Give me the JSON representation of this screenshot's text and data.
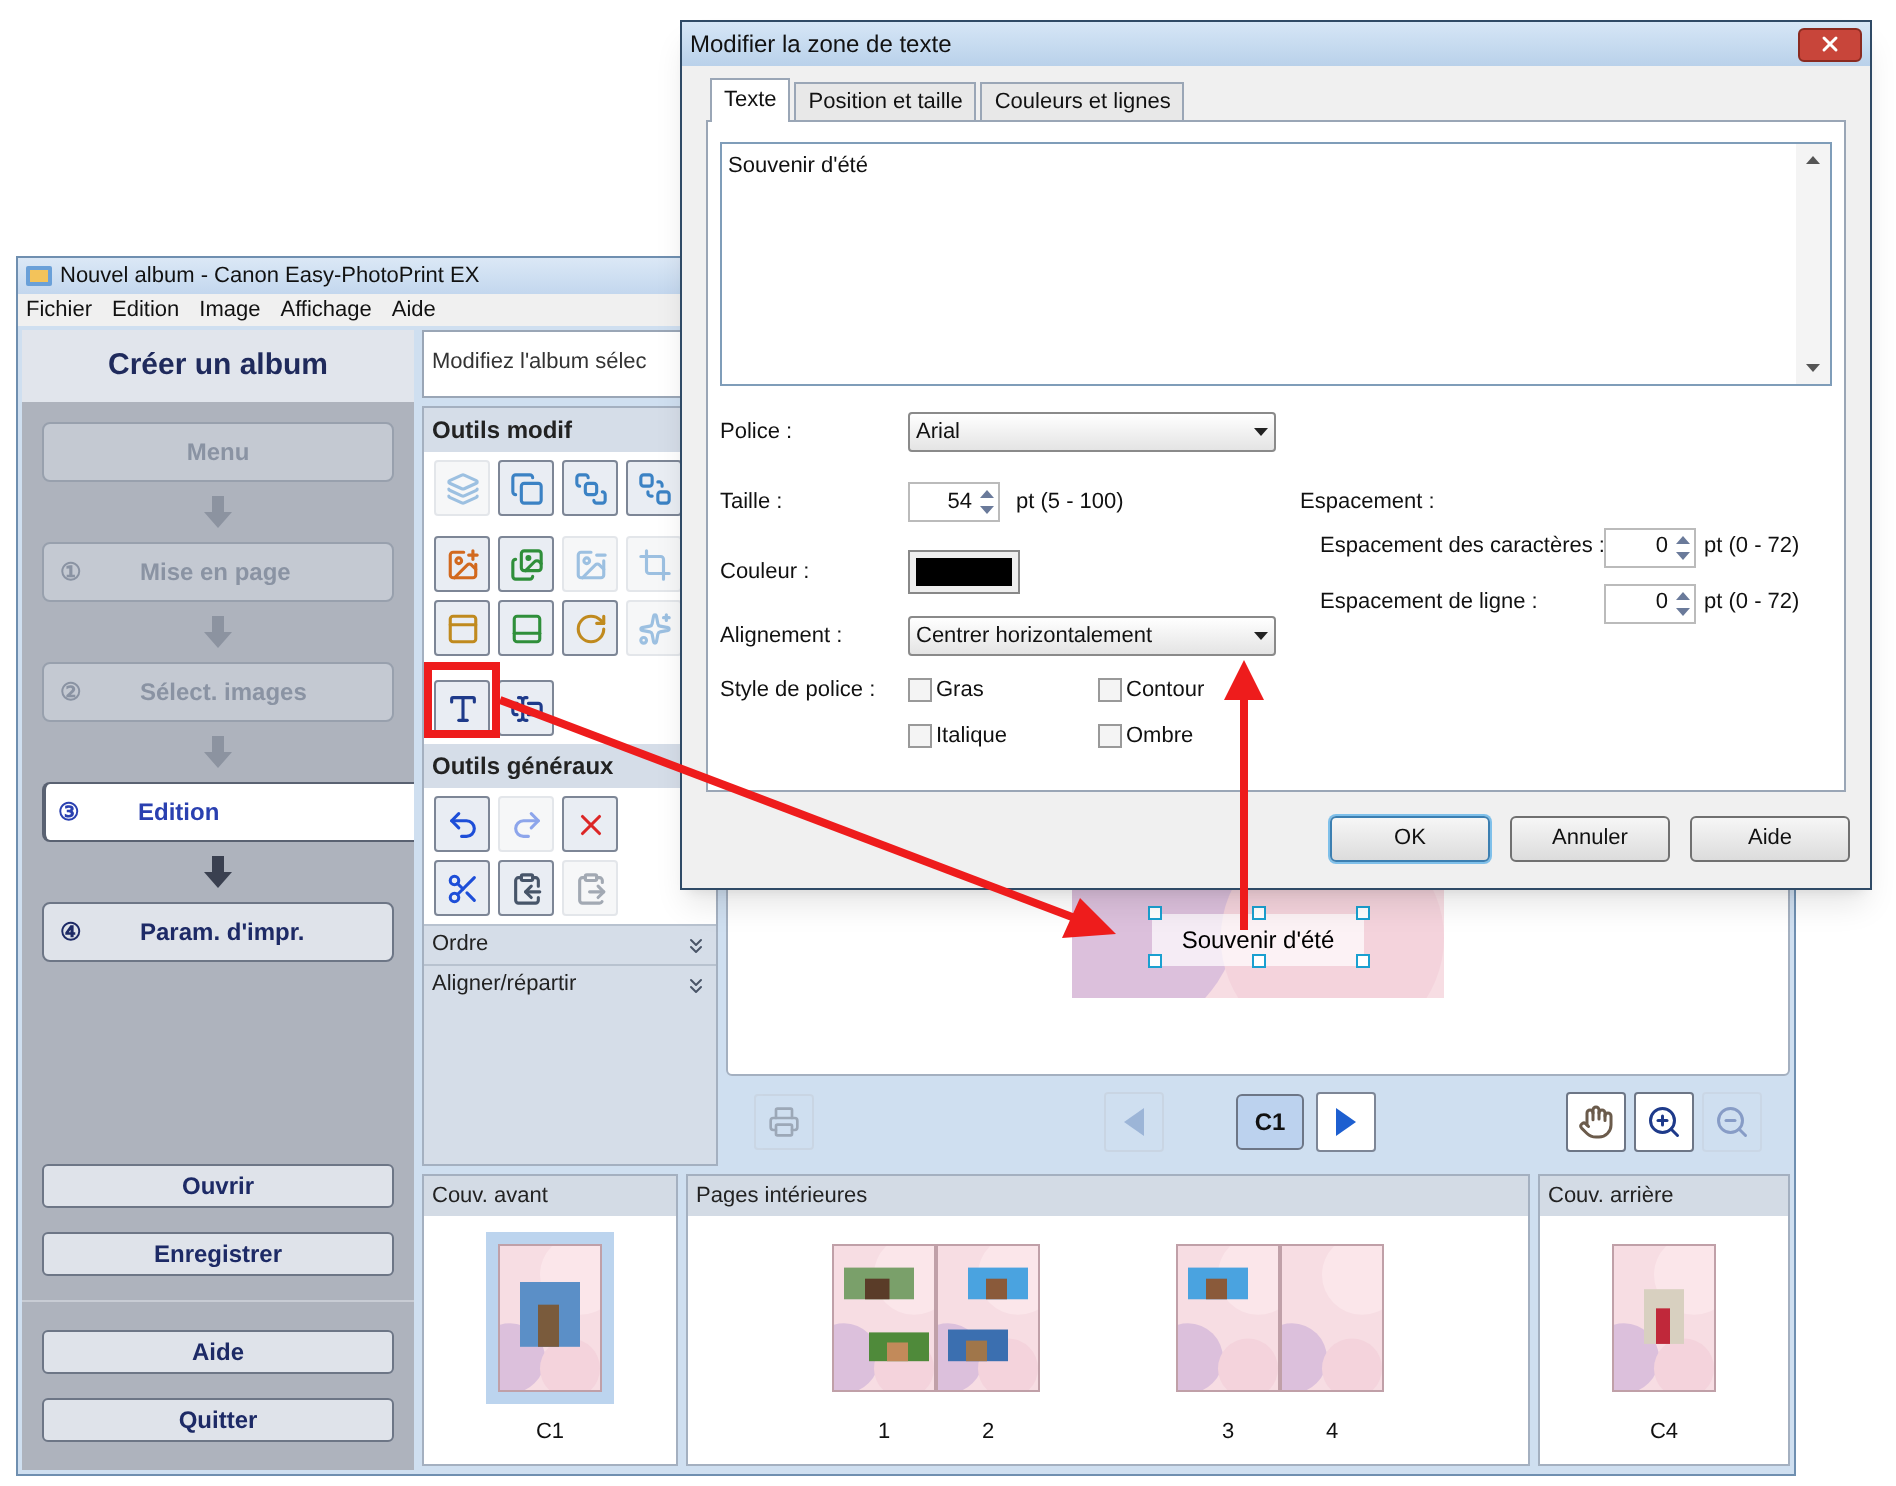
{
  "window": {
    "title": "Nouvel album - Canon Easy-PhotoPrint EX"
  },
  "menu": [
    "Fichier",
    "Edition",
    "Image",
    "Affichage",
    "Aide"
  ],
  "sidebar": {
    "title": "Créer un album",
    "steps": [
      {
        "label": "Menu",
        "disabled": true,
        "selected": false
      },
      {
        "number": "①",
        "label": "Mise en page",
        "disabled": true,
        "selected": false
      },
      {
        "number": "②",
        "label": "Sélect. images",
        "disabled": true,
        "selected": false
      },
      {
        "number": "③",
        "label": "Edition",
        "disabled": false,
        "selected": true
      },
      {
        "number": "④",
        "label": "Param. d'impr.",
        "disabled": false,
        "selected": false
      }
    ],
    "file_buttons": [
      "Ouvrir",
      "Enregistrer"
    ],
    "app_buttons": [
      "Aide",
      "Quitter"
    ]
  },
  "description": "Modifiez l'album sélec",
  "tool_groups": [
    {
      "title": "Outils modif",
      "rows": [
        [
          {
            "kind": "layers",
            "disabled": true
          },
          {
            "kind": "copy",
            "disabled": false
          },
          {
            "kind": "front",
            "disabled": false
          },
          {
            "kind": "back",
            "disabled": false
          }
        ],
        [
          {
            "kind": "image-add",
            "disabled": false
          },
          {
            "kind": "images",
            "disabled": false
          },
          {
            "kind": "image-remove",
            "disabled": true
          },
          {
            "kind": "crop",
            "disabled": true
          }
        ],
        [
          {
            "kind": "frame-top",
            "disabled": false
          },
          {
            "kind": "frame-bottom",
            "disabled": false
          },
          {
            "kind": "rotate",
            "disabled": false
          },
          {
            "kind": "effect",
            "disabled": true
          }
        ],
        [
          {
            "kind": "text-add",
            "disabled": false
          },
          {
            "kind": "text-edit",
            "disabled": false
          }
        ]
      ]
    },
    {
      "title": "Outils généraux",
      "rows": [
        [
          {
            "kind": "undo",
            "disabled": false
          },
          {
            "kind": "redo",
            "disabled": true
          },
          {
            "kind": "delete",
            "disabled": false
          }
        ],
        [
          {
            "kind": "cut",
            "disabled": false
          },
          {
            "kind": "clipboard-copy",
            "disabled": false
          },
          {
            "kind": "paste",
            "disabled": true
          }
        ]
      ]
    }
  ],
  "collapsed_sections": [
    "Ordre",
    "Aligner/répartir"
  ],
  "canvas": {
    "text_box": "Souvenir d'été"
  },
  "nav": {
    "print": {
      "disabled": true
    },
    "prev": {
      "disabled": true
    },
    "page": "C1",
    "next": {
      "disabled": false
    },
    "view_tools": [
      {
        "kind": "hand",
        "disabled": false
      },
      {
        "kind": "zoom-in",
        "disabled": false
      },
      {
        "kind": "zoom-out",
        "disabled": true
      }
    ]
  },
  "pages_strip": [
    {
      "title": "Couv. avant",
      "spreads": [
        {
          "selected": true,
          "pages": [
            "C1"
          ]
        }
      ]
    },
    {
      "title": "Pages intérieures",
      "spreads": [
        {
          "selected": false,
          "pages": [
            "1",
            "2"
          ]
        },
        {
          "selected": false,
          "pages": [
            "3",
            "4"
          ]
        }
      ]
    },
    {
      "title": "Couv. arrière",
      "spreads": [
        {
          "selected": false,
          "pages": [
            "C4"
          ]
        }
      ]
    }
  ],
  "dialog": {
    "title": "Modifier la zone de texte",
    "tabs": [
      {
        "label": "Texte",
        "selected": true
      },
      {
        "label": "Position et taille",
        "selected": false
      },
      {
        "label": "Couleurs et lignes",
        "selected": false
      }
    ],
    "text": "Souvenir d'été",
    "font": {
      "label": "Police :",
      "value": "Arial"
    },
    "size": {
      "label": "Taille :",
      "value": "54",
      "range": "pt (5 - 100)"
    },
    "color": {
      "label": "Couleur :",
      "color": "#000000"
    },
    "alignment": {
      "label": "Alignement :",
      "value": "Centrer horizontalement"
    },
    "style": {
      "label": "Style de police :",
      "options": [
        {
          "label": "Gras",
          "checked": false
        },
        {
          "label": "Contour",
          "checked": false
        },
        {
          "label": "Italique",
          "checked": false
        },
        {
          "label": "Ombre",
          "checked": false
        }
      ]
    },
    "spacing": {
      "title": "Espacement :",
      "rows": [
        {
          "label": "Espacement des caractères :",
          "value": "0",
          "range": "pt (0 - 72)"
        },
        {
          "label": "Espacement de ligne :",
          "value": "0",
          "range": "pt (0 - 72)"
        }
      ]
    },
    "buttons": [
      {
        "label": "OK",
        "default": true
      },
      {
        "label": "Annuler",
        "default": false
      },
      {
        "label": "Aide",
        "default": false
      }
    ]
  }
}
